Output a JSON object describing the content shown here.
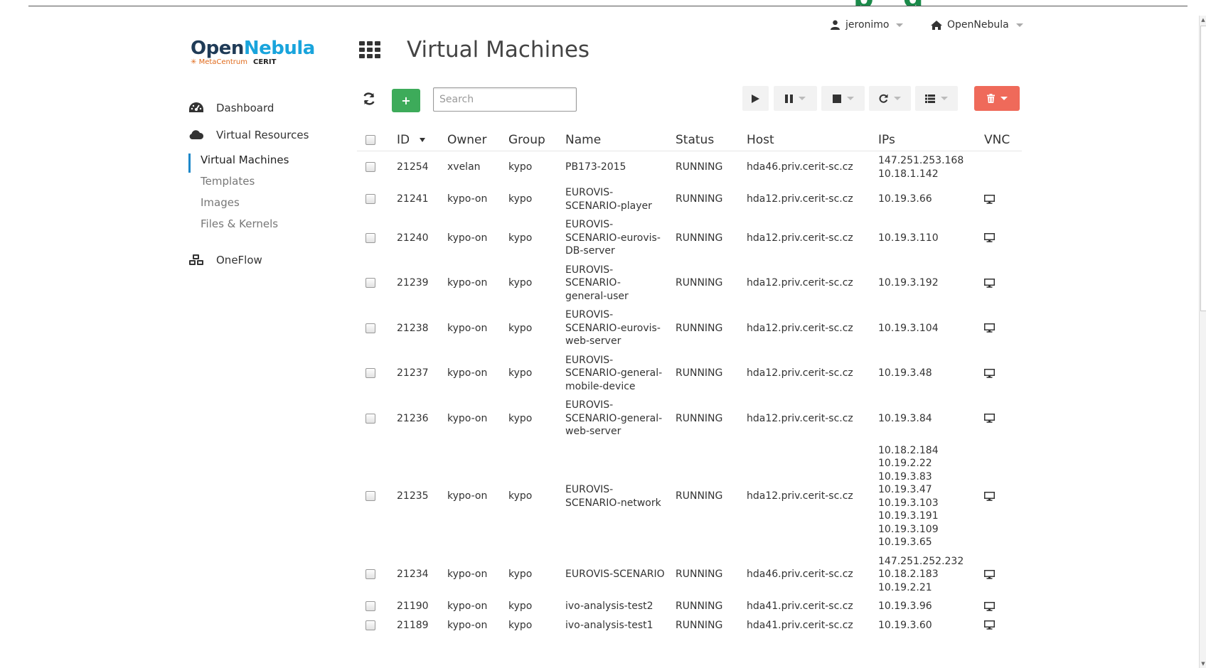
{
  "user_bar": {
    "user": "jeronimo",
    "zone": "OpenNebula"
  },
  "logo": {
    "open": "Open",
    "nebula": "Nebula",
    "sub_left": "MetaCentrum",
    "sub_right": "CERIT"
  },
  "sidebar": {
    "dashboard": "Dashboard",
    "virtual_resources": "Virtual Resources",
    "sub_items": [
      "Virtual Machines",
      "Templates",
      "Images",
      "Files & Kernels"
    ],
    "oneflow": "OneFlow"
  },
  "header": {
    "title": "Virtual Machines"
  },
  "toolbar": {
    "add_label": "+",
    "search_placeholder": "Search"
  },
  "table": {
    "columns": [
      "ID",
      "Owner",
      "Group",
      "Name",
      "Status",
      "Host",
      "IPs",
      "VNC"
    ],
    "rows": [
      {
        "id": "21254",
        "owner": "xvelan",
        "group": "kypo",
        "name": [
          "PB173-2015"
        ],
        "status": "RUNNING",
        "host": "hda46.priv.cerit-sc.cz",
        "ips": [
          "147.251.253.168",
          "10.18.1.142"
        ],
        "vnc": false
      },
      {
        "id": "21241",
        "owner": "kypo-on",
        "group": "kypo",
        "name": [
          "EUROVIS-",
          "SCENARIO-player"
        ],
        "status": "RUNNING",
        "host": "hda12.priv.cerit-sc.cz",
        "ips": [
          "10.19.3.66"
        ],
        "vnc": true
      },
      {
        "id": "21240",
        "owner": "kypo-on",
        "group": "kypo",
        "name": [
          "EUROVIS-",
          "SCENARIO-eurovis-",
          "DB-server"
        ],
        "status": "RUNNING",
        "host": "hda12.priv.cerit-sc.cz",
        "ips": [
          "10.19.3.110"
        ],
        "vnc": true
      },
      {
        "id": "21239",
        "owner": "kypo-on",
        "group": "kypo",
        "name": [
          "EUROVIS-",
          "SCENARIO-",
          "general-user"
        ],
        "status": "RUNNING",
        "host": "hda12.priv.cerit-sc.cz",
        "ips": [
          "10.19.3.192"
        ],
        "vnc": true
      },
      {
        "id": "21238",
        "owner": "kypo-on",
        "group": "kypo",
        "name": [
          "EUROVIS-",
          "SCENARIO-eurovis-",
          "web-server"
        ],
        "status": "RUNNING",
        "host": "hda12.priv.cerit-sc.cz",
        "ips": [
          "10.19.3.104"
        ],
        "vnc": true
      },
      {
        "id": "21237",
        "owner": "kypo-on",
        "group": "kypo",
        "name": [
          "EUROVIS-",
          "SCENARIO-general-",
          "mobile-device"
        ],
        "status": "RUNNING",
        "host": "hda12.priv.cerit-sc.cz",
        "ips": [
          "10.19.3.48"
        ],
        "vnc": true
      },
      {
        "id": "21236",
        "owner": "kypo-on",
        "group": "kypo",
        "name": [
          "EUROVIS-",
          "SCENARIO-general-",
          "web-server"
        ],
        "status": "RUNNING",
        "host": "hda12.priv.cerit-sc.cz",
        "ips": [
          "10.19.3.84"
        ],
        "vnc": true
      },
      {
        "id": "21235",
        "owner": "kypo-on",
        "group": "kypo",
        "name": [
          "EUROVIS-",
          "SCENARIO-network"
        ],
        "status": "RUNNING",
        "host": "hda12.priv.cerit-sc.cz",
        "ips": [
          "10.18.2.184",
          "10.19.2.22",
          "10.19.3.83",
          "10.19.3.47",
          "10.19.3.103",
          "10.19.3.191",
          "10.19.3.109",
          "10.19.3.65"
        ],
        "vnc": true
      },
      {
        "id": "21234",
        "owner": "kypo-on",
        "group": "kypo",
        "name": [
          "EUROVIS-SCENARIO"
        ],
        "status": "RUNNING",
        "host": "hda46.priv.cerit-sc.cz",
        "ips": [
          "147.251.252.232",
          "10.18.2.183",
          "10.19.2.21"
        ],
        "vnc": true
      },
      {
        "id": "21190",
        "owner": "kypo-on",
        "group": "kypo",
        "name": [
          "ivo-analysis-test2"
        ],
        "status": "RUNNING",
        "host": "hda41.priv.cerit-sc.cz",
        "ips": [
          "10.19.3.96"
        ],
        "vnc": true
      },
      {
        "id": "21189",
        "owner": "kypo-on",
        "group": "kypo",
        "name": [
          "ivo-analysis-test1"
        ],
        "status": "RUNNING",
        "host": "hda41.priv.cerit-sc.cz",
        "ips": [
          "10.19.3.60"
        ],
        "vnc": true
      }
    ]
  },
  "colors": {
    "accent": "#1e88c9",
    "add_button": "#3dab5a",
    "delete_button": "#ef6a5a",
    "logo_dark": "#1f3b57",
    "logo_light": "#19a4dc"
  }
}
